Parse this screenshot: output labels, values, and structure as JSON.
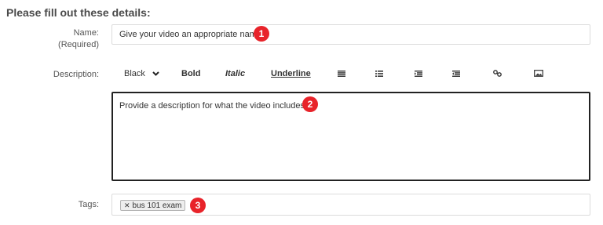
{
  "heading": "Please fill out these details:",
  "name": {
    "label": "Name:",
    "required": "(Required)",
    "value": "Give your video an appropriate name"
  },
  "description": {
    "label": "Description:",
    "toolbar": {
      "color": "Black",
      "bold": "Bold",
      "italic": "Italic",
      "underline": "Underline"
    },
    "value": "Provide a description for what the video includes"
  },
  "tags": {
    "label": "Tags:",
    "items": [
      "bus 101 exam"
    ]
  },
  "callouts": [
    "1",
    "2",
    "3"
  ],
  "icons": [
    "chevron-down-icon",
    "align-left-icon",
    "list-icon",
    "outdent-icon",
    "indent-icon",
    "link-icon",
    "image-icon",
    "close-icon"
  ],
  "colors": {
    "callout": "#e8232a",
    "active_border": "#222222"
  }
}
